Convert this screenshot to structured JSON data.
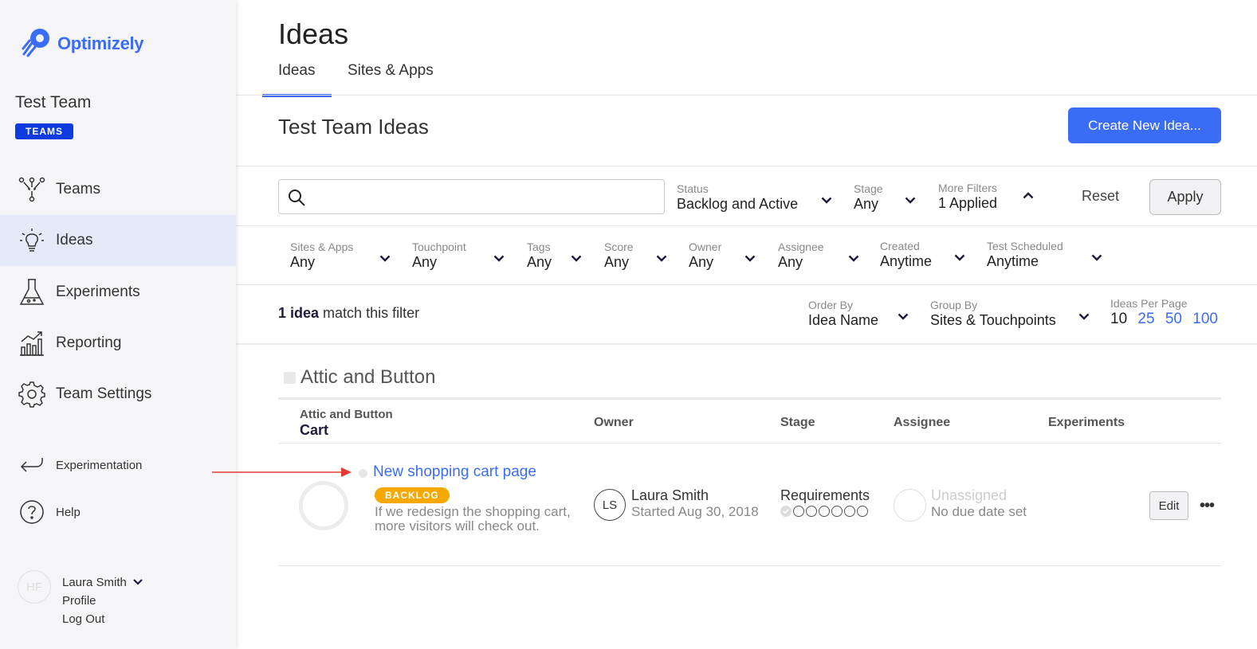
{
  "brand": {
    "name": "Optimizely",
    "accent": "#3b6cf6"
  },
  "team": {
    "name": "Test Team",
    "badge": "TEAMS"
  },
  "nav": [
    {
      "label": "Teams",
      "icon": "teams-icon"
    },
    {
      "label": "Ideas",
      "icon": "lightbulb-icon",
      "active": true
    },
    {
      "label": "Experiments",
      "icon": "flask-icon"
    },
    {
      "label": "Reporting",
      "icon": "reporting-chart-icon"
    },
    {
      "label": "Team Settings",
      "icon": "gear-icon"
    }
  ],
  "aux_nav": [
    {
      "label": "Experimentation",
      "icon": "return-arrow-icon"
    },
    {
      "label": "Help",
      "icon": "help-icon"
    }
  ],
  "user": {
    "initials": "HF",
    "name": "Laura Smith",
    "profile": "Profile",
    "logout": "Log Out"
  },
  "page": {
    "title": "Ideas",
    "tabs": [
      {
        "label": "Ideas",
        "active": true
      },
      {
        "label": "Sites & Apps"
      }
    ],
    "section_title": "Test Team Ideas",
    "create_button": "Create New Idea..."
  },
  "filters": {
    "search_value": "",
    "status": {
      "label": "Status",
      "value": "Backlog and Active"
    },
    "stage": {
      "label": "Stage",
      "value": "Any"
    },
    "more_filters": {
      "label": "More Filters",
      "value": "1 Applied"
    },
    "reset": "Reset",
    "apply": "Apply",
    "secondary": [
      {
        "label": "Sites & Apps",
        "value": "Any"
      },
      {
        "label": "Touchpoint",
        "value": "Any"
      },
      {
        "label": "Tags",
        "value": "Any"
      },
      {
        "label": "Score",
        "value": "Any"
      },
      {
        "label": "Owner",
        "value": "Any"
      },
      {
        "label": "Assignee",
        "value": "Any"
      },
      {
        "label": "Created",
        "value": "Anytime"
      },
      {
        "label": "Test Scheduled",
        "value": "Anytime"
      }
    ]
  },
  "results": {
    "count": "1 idea",
    "suffix": "match this filter",
    "order_by": {
      "label": "Order By",
      "value": "Idea Name"
    },
    "group_by": {
      "label": "Group By",
      "value": "Sites & Touchpoints"
    },
    "per_page": {
      "label": "Ideas Per Page",
      "options": [
        "10",
        "25",
        "50",
        "100"
      ],
      "selected": "10"
    }
  },
  "group": {
    "title": "Attic and Button",
    "header": {
      "site": "Attic and Button",
      "touchpoint": "Cart",
      "owner": "Owner",
      "stage": "Stage",
      "assignee": "Assignee",
      "experiments": "Experiments"
    },
    "ideas": [
      {
        "title": "New shopping cart page",
        "badge": "BACKLOG",
        "description": "If we redesign the shopping cart, more visitors will check out.",
        "owner_initials": "LS",
        "owner_name": "Laura Smith",
        "owner_started": "Started Aug 30, 2018",
        "stage": "Requirements",
        "stage_progress": "1 of 7",
        "assignee": "Unassigned",
        "due": "No due date set",
        "edit": "Edit",
        "more": "•••"
      }
    ]
  },
  "colors": {
    "badge_backlog": "#f5a800",
    "teams_badge": "#0d3be0",
    "annotation_arrow": "#e53935"
  }
}
